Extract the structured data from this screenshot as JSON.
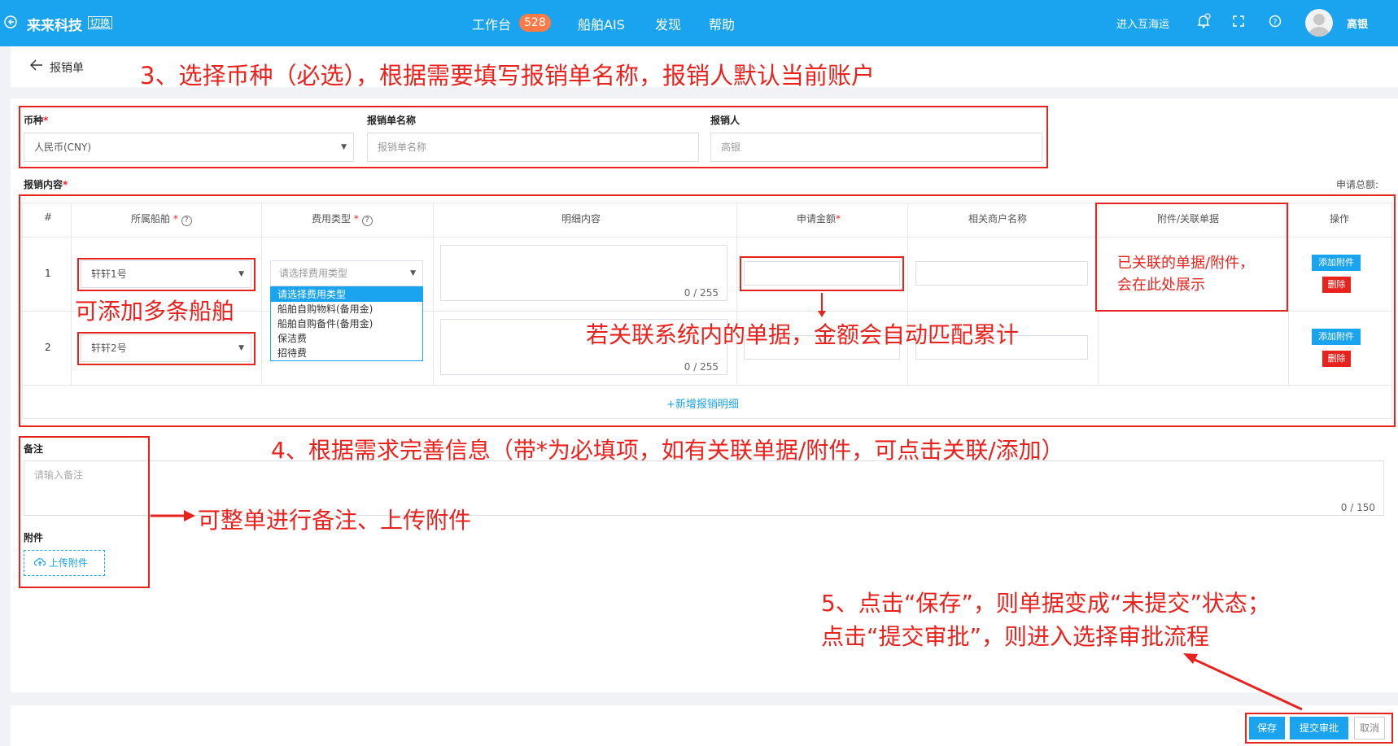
{
  "topbar": {
    "brand": "来来科技",
    "switch_label": "切换",
    "nav": [
      "工作台",
      "船舶AIS",
      "发现",
      "帮助"
    ],
    "badge": "528",
    "enter_link": "进入互海运",
    "username": "高银"
  },
  "page": {
    "back_label": "报销单"
  },
  "form": {
    "currency_label": "币种",
    "currency_value": "人民币(CNY)",
    "name_label": "报销单名称",
    "name_placeholder": "报销单名称",
    "applicant_label": "报销人",
    "applicant_value": "高银",
    "content_label": "报销内容",
    "total_label": "申请总额:"
  },
  "table": {
    "headers": [
      "#",
      "所属船舶",
      "费用类型",
      "明细内容",
      "申请金额",
      "相关商户名称",
      "附件/关联单据",
      "操作"
    ],
    "rows": [
      {
        "index": "1",
        "ship": "轩轩1号",
        "fee_placeholder": "请选择费用类型",
        "counter": "0 / 255"
      },
      {
        "index": "2",
        "ship": "轩轩2号",
        "counter": "0 / 255"
      }
    ],
    "fee_options": [
      "请选择费用类型",
      "船舶自购物料(备用金)",
      "船舶自购备件(备用金)",
      "保洁费",
      "招待费"
    ],
    "add_attach": "添加附件",
    "delete": "删除",
    "add_row": "+新增报销明细"
  },
  "remark": {
    "label": "备注",
    "placeholder": "请输入备注",
    "counter": "0 / 150"
  },
  "attachment": {
    "label": "附件",
    "upload": "上传附件"
  },
  "footer": {
    "save": "保存",
    "submit": "提交审批",
    "cancel": "取消"
  },
  "annotations": {
    "step3": "3、选择币种（必选），根据需要填写报销单名称，报销人默认当前账户",
    "multi_ship": "可添加多条船舶",
    "linked_line1": "已关联的单据/附件，",
    "linked_line2": "会在此处展示",
    "auto_sum": "若关联系统内的单据，金额会自动匹配累计",
    "step4": "4、根据需求完善信息（带*为必填项，如有关联单据/附件，可点击关联/添加）",
    "remark_note": "可整单进行备注、上传附件",
    "step5_line1": "5、点击“保存”，则单据变成“未提交”状态；",
    "step5_line2": "点击“提交审批”，则进入选择审批流程"
  },
  "colors": {
    "brand_blue": "#1aa3ee",
    "annotation_red": "#e8231e",
    "badge_orange": "#ff7a45"
  }
}
